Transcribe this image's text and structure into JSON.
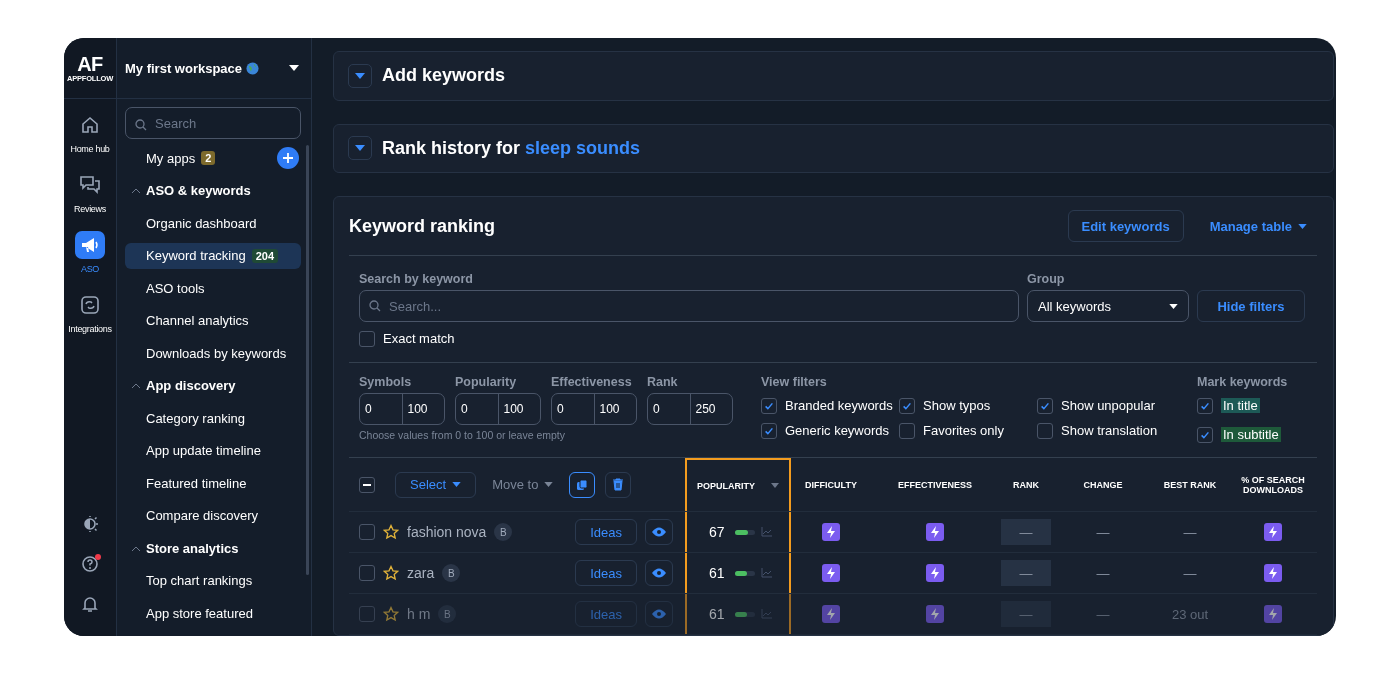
{
  "app": {
    "logo": "AF",
    "logo_caption": "APPFOLLOW",
    "workspace": "My first workspace"
  },
  "rail": [
    {
      "label": "Home hub",
      "kind": "home",
      "selected": false
    },
    {
      "label": "Reviews",
      "kind": "chat",
      "selected": false
    },
    {
      "label": "ASO",
      "kind": "megaphone",
      "selected": true
    },
    {
      "label": "Integrations",
      "kind": "sync",
      "selected": false
    }
  ],
  "rail_tools": [
    {
      "kind": "theme",
      "alert": false
    },
    {
      "kind": "help",
      "alert": true
    },
    {
      "kind": "bell",
      "alert": false
    }
  ],
  "sidebar": {
    "search": {
      "placeholder": "Search"
    },
    "items": [
      {
        "kind": "link",
        "label": "My apps",
        "badge": {
          "text": "2",
          "color": "#7d6a2c"
        },
        "add": true,
        "selected": false
      },
      {
        "kind": "section",
        "label": "ASO & keywords",
        "expanded": true
      },
      {
        "kind": "link",
        "label": "Organic dashboard",
        "selected": false
      },
      {
        "kind": "link",
        "label": "Keyword tracking",
        "badge": {
          "text": "204",
          "color": "#1f4a35"
        },
        "selected": true
      },
      {
        "kind": "link",
        "label": "ASO tools",
        "selected": false
      },
      {
        "kind": "link",
        "label": "Channel analytics",
        "selected": false
      },
      {
        "kind": "link",
        "label": "Downloads by keywords",
        "selected": false
      },
      {
        "kind": "section",
        "label": "App discovery",
        "expanded": true
      },
      {
        "kind": "link",
        "label": "Category ranking",
        "selected": false
      },
      {
        "kind": "link",
        "label": "App update timeline",
        "selected": false
      },
      {
        "kind": "link",
        "label": "Featured timeline",
        "selected": false
      },
      {
        "kind": "link",
        "label": "Compare discovery",
        "selected": false
      },
      {
        "kind": "section",
        "label": "Store analytics",
        "expanded": true
      },
      {
        "kind": "link",
        "label": "Top chart rankings",
        "selected": false
      },
      {
        "kind": "link",
        "label": "App store featured",
        "selected": false
      }
    ]
  },
  "panels": [
    {
      "title": "Add keywords",
      "expanded": false
    },
    {
      "title": "Rank history for",
      "highlight": "sleep sounds",
      "expanded": false
    }
  ],
  "ranking": {
    "title": "Keyword ranking",
    "edit_button": "Edit keywords",
    "manage_button": "Manage table",
    "search_label": "Search by keyword",
    "search_placeholder": "Search...",
    "group_label": "Group",
    "group_value": "All keywords",
    "hide_filters": "Hide filters",
    "exact_match": {
      "label": "Exact match",
      "checked": false
    },
    "ranges": [
      {
        "label": "Symbols",
        "min": "0",
        "max": "100"
      },
      {
        "label": "Popularity",
        "min": "0",
        "max": "100"
      },
      {
        "label": "Effectiveness",
        "min": "0",
        "max": "100"
      },
      {
        "label": "Rank",
        "min": "0",
        "max": "250"
      }
    ],
    "range_hint": "Choose values from 0 to 100 or leave empty",
    "view_filters_label": "View filters",
    "view_filters": [
      {
        "label": "Branded keywords",
        "checked": true
      },
      {
        "label": "Generic keywords",
        "checked": true
      },
      {
        "label": "Show typos",
        "checked": true
      },
      {
        "label": "Favorites only",
        "checked": false
      },
      {
        "label": "Show unpopular",
        "checked": true
      },
      {
        "label": "Show translation",
        "checked": false
      }
    ],
    "mark_keywords_label": "Mark keywords",
    "mark_keywords": [
      {
        "label": "In title",
        "checked": true,
        "color": "#1d5a56"
      },
      {
        "label": "In subtitle",
        "checked": true,
        "color": "#1e5a3a"
      }
    ]
  },
  "table": {
    "header_checkbox": {
      "indeterminate": true
    },
    "select_button": "Select",
    "move_to": {
      "label": "Move to",
      "disabled": true
    },
    "copy_selected": true,
    "columns": [
      {
        "label": "POPULARITY",
        "sorted": true,
        "highlighted": true
      },
      {
        "label": "DIFFICULTY",
        "sorted": false,
        "highlighted": false
      },
      {
        "label": "EFFECTIVENESS",
        "sorted": false,
        "highlighted": false
      },
      {
        "label": "RANK",
        "sorted": false,
        "highlighted": false
      },
      {
        "label": "CHANGE",
        "sorted": false,
        "highlighted": false
      },
      {
        "label": "BEST RANK",
        "sorted": false,
        "highlighted": false
      },
      {
        "label": "% OF SEARCH DOWNLOADS",
        "sorted": false,
        "highlighted": false
      }
    ],
    "rows": [
      {
        "checked": false,
        "favorite": false,
        "keyword": "fashion nova",
        "badge": "B",
        "ideas": "Ideas",
        "watching": true,
        "faded": false,
        "cells": [
          {
            "kind": "popularity",
            "text": "67",
            "level": 0.67
          },
          {
            "kind": "bolt"
          },
          {
            "kind": "bolt"
          },
          {
            "kind": "rank",
            "text": "—"
          },
          {
            "kind": "text",
            "text": "—"
          },
          {
            "kind": "text",
            "text": "—"
          },
          {
            "kind": "bolt"
          }
        ]
      },
      {
        "checked": false,
        "favorite": false,
        "keyword": "zara",
        "badge": "B",
        "ideas": "Ideas",
        "watching": true,
        "faded": false,
        "cells": [
          {
            "kind": "popularity",
            "text": "61",
            "level": 0.61
          },
          {
            "kind": "bolt"
          },
          {
            "kind": "bolt"
          },
          {
            "kind": "rank",
            "text": "—"
          },
          {
            "kind": "text",
            "text": "—"
          },
          {
            "kind": "text",
            "text": "—"
          },
          {
            "kind": "bolt"
          }
        ]
      },
      {
        "checked": false,
        "favorite": false,
        "keyword": "h m",
        "badge": "B",
        "ideas": "Ideas",
        "watching": true,
        "faded": true,
        "cells": [
          {
            "kind": "popularity",
            "text": "61",
            "level": 0.61
          },
          {
            "kind": "bolt"
          },
          {
            "kind": "bolt"
          },
          {
            "kind": "rank",
            "text": "—"
          },
          {
            "kind": "text",
            "text": "—"
          },
          {
            "kind": "text",
            "text": "23 out"
          },
          {
            "kind": "bolt"
          }
        ]
      }
    ]
  }
}
